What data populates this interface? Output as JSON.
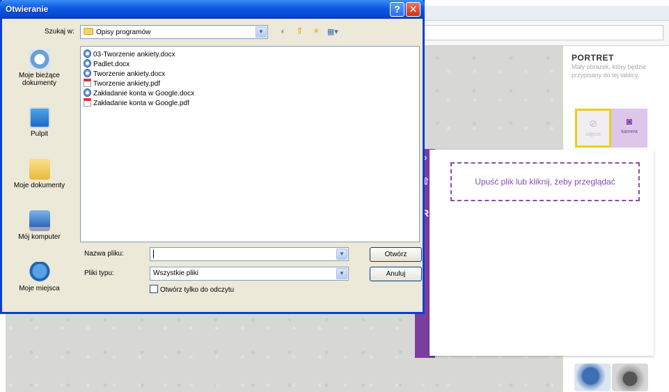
{
  "dialog": {
    "title": "Otwieranie",
    "help_button": "?",
    "close_button": "✕",
    "look_in_label": "Szukaj w:",
    "look_in_value": "Opisy programów",
    "places": [
      {
        "label": "Moje bieżące dokumenty",
        "icon": "recent-documents-icon"
      },
      {
        "label": "Pulpit",
        "icon": "desktop-icon"
      },
      {
        "label": "Moje dokumenty",
        "icon": "my-documents-icon"
      },
      {
        "label": "Mój komputer",
        "icon": "my-computer-icon"
      },
      {
        "label": "Moje miejsca",
        "icon": "network-places-icon"
      }
    ],
    "files": [
      {
        "name": "03-Tworzenie ankiety.docx",
        "type": "docx"
      },
      {
        "name": "Padlet.docx",
        "type": "docx"
      },
      {
        "name": "Tworzenie ankiety.docx",
        "type": "docx"
      },
      {
        "name": "Tworzenie ankiety.pdf",
        "type": "pdf"
      },
      {
        "name": "Zakładanie konta w Google.docx",
        "type": "docx"
      },
      {
        "name": "Zakładanie konta w Google.pdf",
        "type": "pdf"
      }
    ],
    "file_name_label": "Nazwa pliku:",
    "file_name_value": "",
    "file_type_label": "Pliki typu:",
    "file_type_value": "Wszystkie pliki",
    "open_button": "Otwórz",
    "cancel_button": "Anuluj",
    "read_only_label": "Otwórz tylko do odczytu"
  },
  "portret": {
    "title": "PORTRET",
    "description": "Mały obrazek, który będzie przypisany do tej tablicy.",
    "photo_label": "zdjęcie",
    "camera_label": "kamera"
  },
  "upload": {
    "dropzone_text": "Upuść plik lub kliknij, żeby przeglądać"
  },
  "colors": {
    "xp_title_blue": "#0b58e0",
    "purple_accent": "#7a3ea0",
    "highlight_yellow": "#e8cf1a"
  }
}
